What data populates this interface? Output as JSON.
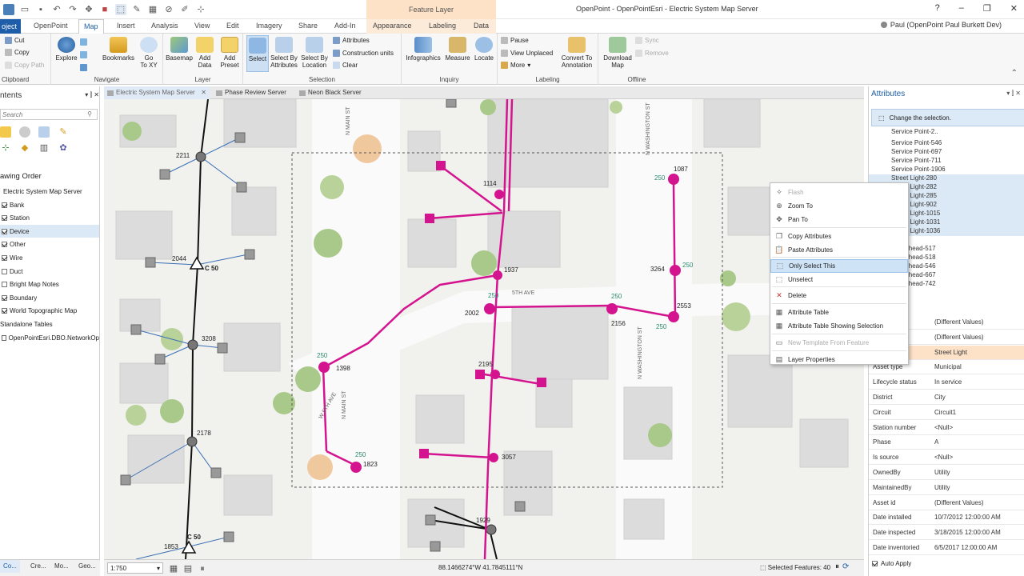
{
  "app": {
    "title": "OpenPoint - OpenPointEsri - Electric System Map Server",
    "context_tab_group": "Feature Layer",
    "user": "Paul (OpenPoint Paul Burkett Dev)",
    "help": "?"
  },
  "ribbon_tabs": [
    "Project",
    "OpenPoint",
    "Map",
    "Insert",
    "Analysis",
    "View",
    "Edit",
    "Imagery",
    "Share",
    "Add-In",
    "Appearance",
    "Labeling",
    "Data"
  ],
  "ribbon_tab_short": {
    "project": "oject"
  },
  "ribbon": {
    "clipboard": {
      "label": "Clipboard",
      "cut": "Cut",
      "copy": "Copy",
      "copy_path": "Copy Path"
    },
    "navigate": {
      "label": "Navigate",
      "explore": "Explore",
      "bookmarks": "Bookmarks",
      "goto": "Go\nTo XY"
    },
    "layer": {
      "label": "Layer",
      "basemap": "Basemap",
      "add_data": "Add\nData",
      "add_preset": "Add\nPreset"
    },
    "selection": {
      "label": "Selection",
      "select": "Select",
      "select_by_attr": "Select By\nAttributes",
      "select_by_loc": "Select By\nLocation",
      "attributes": "Attributes",
      "construction_units": "Construction units",
      "clear": "Clear"
    },
    "inquiry": {
      "label": "Inquiry",
      "infographics": "Infographics",
      "measure": "Measure",
      "locate": "Locate"
    },
    "labeling": {
      "label": "Labeling",
      "pause": "Pause",
      "view_unplaced": "View Unplaced",
      "more": "More",
      "convert": "Convert To\nAnnotation"
    },
    "offline": {
      "label": "Offline",
      "download": "Download\nMap",
      "sync": "Sync",
      "remove": "Remove"
    }
  },
  "contents": {
    "title": "ntents",
    "search_placeholder": "Search",
    "drawing_order": "awing Order",
    "map_name": "Electric System Map Server",
    "layers": [
      {
        "name": "Bank",
        "checked": true
      },
      {
        "name": "Station",
        "checked": true
      },
      {
        "name": "Device",
        "checked": true
      },
      {
        "name": "Other",
        "checked": true
      },
      {
        "name": "Wire",
        "checked": true
      },
      {
        "name": "Duct",
        "checked": false
      },
      {
        "name": "Bright Map Notes",
        "checked": false
      },
      {
        "name": "Boundary",
        "checked": true
      },
      {
        "name": "World Topographic Map",
        "checked": true
      }
    ],
    "standalone": "Standalone Tables",
    "table_item": "OpenPointEsri.DBO.NetworkOp"
  },
  "bottom_tabs": [
    "Co...",
    "Cre...",
    "Mo...",
    "Geo..."
  ],
  "doc_tabs": [
    "Electric System Map Server",
    "Phase Review Server",
    "Neon Black Server"
  ],
  "map": {
    "streets": [
      "N MAIN ST",
      "N WASHINGTON ST",
      "5TH AVE",
      "W 5TH AVE",
      "N MAIN ST",
      "N WASHINGTON ST"
    ],
    "street_partial": "OTH AVE",
    "labels": [
      "2211",
      "2044",
      "C 50",
      "3208",
      "2178",
      "1853",
      "C 50",
      "1114",
      "1937",
      "2002",
      "250",
      "1087",
      "250",
      "3264",
      "250",
      "2553",
      "250",
      "2156",
      "250",
      "2195",
      "1398",
      "250",
      "3057",
      "1823",
      "250",
      "1929"
    ]
  },
  "status": {
    "scale": "1:750",
    "coords": "88.1466274°W 41.7845111°N",
    "selected": "Selected Features: 40"
  },
  "attributes": {
    "title": "Attributes",
    "hint": "Change the selection.",
    "tree": [
      "Service Point-2..",
      "Service Point-546",
      "Service Point-697",
      "Service Point-711",
      "Service Point-1906",
      "Street Light-280",
      "Street Light-282",
      "Street Light-285",
      "Street Light-902",
      "Street Light-1015",
      "Street Light-1031",
      "Street Light-1036",
      "y overhead-517",
      "y overhead-518",
      "y overhead-546",
      "y overhead-667",
      "y overhead-742"
    ],
    "props": [
      {
        "k": "",
        "v": "(Different Values)"
      },
      {
        "k": "",
        "v": "(Different Values)"
      },
      {
        "k": "",
        "v": "Street Light"
      },
      {
        "k": "Asset type",
        "v": "Municipal"
      },
      {
        "k": "Lifecycle status",
        "v": "In service"
      },
      {
        "k": "District",
        "v": "City"
      },
      {
        "k": "Circuit",
        "v": "Circuit1"
      },
      {
        "k": "Station number",
        "v": "<Null>"
      },
      {
        "k": "Phase",
        "v": "A"
      },
      {
        "k": "Is source",
        "v": "<Null>"
      },
      {
        "k": "OwnedBy",
        "v": "Utility"
      },
      {
        "k": "MaintainedBy",
        "v": "Utility"
      },
      {
        "k": "Asset id",
        "v": "(Different Values)"
      },
      {
        "k": "Date installed",
        "v": "10/7/2012 12:00:00 AM"
      },
      {
        "k": "Date inspected",
        "v": "3/18/2015 12:00:00 AM"
      },
      {
        "k": "Date inventoried",
        "v": "6/5/2017 12:00:00 AM"
      }
    ],
    "auto_apply": "Auto Apply"
  },
  "context_menu": [
    {
      "label": "Flash",
      "disabled": true,
      "icon": "flash-icon"
    },
    {
      "label": "Zoom To",
      "disabled": false,
      "icon": "zoom-icon"
    },
    {
      "label": "Pan To",
      "disabled": false,
      "icon": "pan-icon"
    },
    {
      "label": "Copy Attributes",
      "disabled": false,
      "icon": "copy-icon"
    },
    {
      "label": "Paste Attributes",
      "disabled": false,
      "icon": "paste-icon"
    },
    {
      "label": "Only Select This",
      "disabled": false,
      "icon": "select-icon"
    },
    {
      "label": "Unselect",
      "disabled": false,
      "icon": "unselect-icon"
    },
    {
      "label": "Delete",
      "disabled": false,
      "icon": "delete-icon"
    },
    {
      "label": "Attribute Table",
      "disabled": false,
      "icon": "table-icon"
    },
    {
      "label": "Attribute Table Showing Selection",
      "disabled": false,
      "icon": "table-icon"
    },
    {
      "label": "New Template From Feature",
      "disabled": true,
      "icon": "template-icon"
    },
    {
      "label": "Layer Properties",
      "disabled": false,
      "icon": "properties-icon"
    }
  ],
  "colors": {
    "accent": "#1e5ea8",
    "selection": "#d4148f",
    "context": "#fde2c8"
  }
}
